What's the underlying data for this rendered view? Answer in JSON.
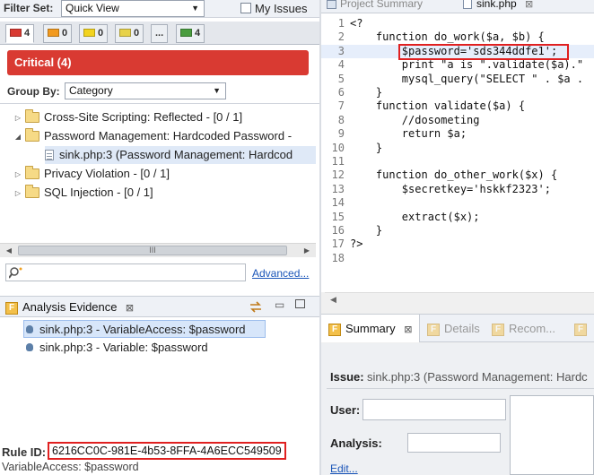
{
  "filter": {
    "label": "Filter Set:",
    "selected": "Quick View",
    "my_issues": "My Issues"
  },
  "severity_tabs": [
    {
      "count": "4",
      "color": "#d93a32"
    },
    {
      "count": "0",
      "color": "#f29a1f"
    },
    {
      "count": "0",
      "color": "#f2d31f"
    },
    {
      "count": "0",
      "color": "#e7d24a"
    },
    {
      "count": "...",
      "color": ""
    },
    {
      "count": "4",
      "color": "#4a9d3f"
    }
  ],
  "critical_header": "Critical (4)",
  "group_by": {
    "label": "Group By:",
    "selected": "Category"
  },
  "tree": {
    "items": [
      {
        "label": "Cross-Site Scripting: Reflected - [0 / 1]"
      },
      {
        "label": "Password Management: Hardcoded Password -"
      },
      {
        "label": "sink.php:3 (Password Management: Hardcod"
      },
      {
        "label": "Privacy Violation - [0 / 1]"
      },
      {
        "label": "SQL Injection - [0 / 1]"
      }
    ],
    "scroll_grip": "III"
  },
  "advanced_link": "Advanced...",
  "evidence": {
    "title": "Analysis Evidence",
    "close": "⊠",
    "rows": [
      "sink.php:3 - VariableAccess: $password",
      "sink.php:3 - Variable: $password"
    ]
  },
  "rule": {
    "label": "Rule ID:",
    "value": "6216CC0C-981E-4b53-8FFA-4A6ECC549509",
    "sub": "VariableAccess: $password"
  },
  "editor": {
    "tabs": {
      "project": "Project Summary",
      "file": "sink.php",
      "close": "⊠"
    },
    "lines": [
      {
        "n": "1",
        "code": "<?"
      },
      {
        "n": "2",
        "code": "    function do_work($a, $b) {"
      },
      {
        "n": "3",
        "code": "        $password='sds344ddfe1';"
      },
      {
        "n": "4",
        "code": "        print \"a is \".validate($a).\""
      },
      {
        "n": "5",
        "code": "        mysql_query(\"SELECT \" . $a ."
      },
      {
        "n": "6",
        "code": "    }"
      },
      {
        "n": "7",
        "code": "    function validate($a) {"
      },
      {
        "n": "8",
        "code": "        //dosometing"
      },
      {
        "n": "9",
        "code": "        return $a;"
      },
      {
        "n": "10",
        "code": "    }"
      },
      {
        "n": "11",
        "code": ""
      },
      {
        "n": "12",
        "code": "    function do_other_work($x) {"
      },
      {
        "n": "13",
        "code": "        $secretkey='hskkf2323';"
      },
      {
        "n": "14",
        "code": ""
      },
      {
        "n": "15",
        "code": "        extract($x);"
      },
      {
        "n": "16",
        "code": "    }"
      },
      {
        "n": "17",
        "code": "?>"
      },
      {
        "n": "18",
        "code": ""
      }
    ]
  },
  "summary": {
    "tabs": [
      "Summary",
      "Details",
      "Recom...",
      ""
    ],
    "issue_label": "Issue:",
    "issue_value": "sink.php:3 (Password Management: Hardc",
    "user_label": "User:",
    "analysis_label": "Analysis:",
    "edit_link": "Edit..."
  }
}
